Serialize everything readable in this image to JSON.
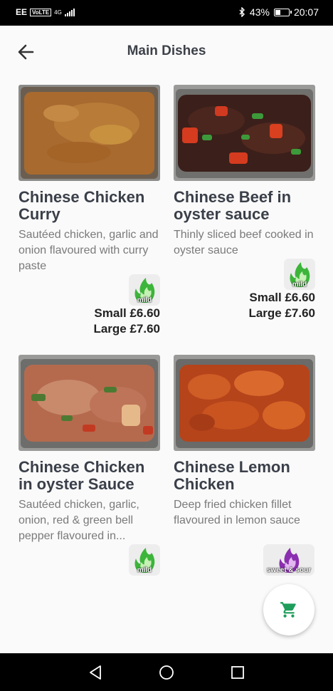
{
  "status_bar": {
    "carrier": "EE",
    "volte": "VoLTE",
    "network": "4G",
    "battery_percent": "43%",
    "battery_level": 0.43,
    "time": "20:07",
    "icons": [
      "signal-icon",
      "bluetooth-icon",
      "battery-icon"
    ]
  },
  "header": {
    "title": "Main Dishes",
    "back_icon": "arrow-left-icon"
  },
  "dishes": [
    {
      "name": "Chinese Chicken Curry",
      "description": "Sautéed chicken, garlic and onion flavoured with curry paste",
      "badge": "mild",
      "price_small": "Small £6.60",
      "price_large": "Large £7.60"
    },
    {
      "name": "Chinese Beef in oyster sauce",
      "description": "Thinly sliced beef cooked in oyster sauce",
      "badge": "mild",
      "price_small": "Small £6.60",
      "price_large": "Large £7.60"
    },
    {
      "name": "Chinese Chicken in oyster Sauce",
      "description": "Sautéed chicken, garlic, onion, red & green bell pepper flavoured in...",
      "badge": "mild"
    },
    {
      "name": "Chinese Lemon Chicken",
      "description": "Deep fried chicken fillet flavoured in lemon sauce",
      "badge": "sweet & sour"
    }
  ],
  "fab": {
    "icon": "shopping-cart-icon"
  },
  "nav_bar": {
    "icons": [
      "back-triangle-icon",
      "home-circle-icon",
      "recents-square-icon"
    ]
  },
  "colors": {
    "accent_green": "#1e9e5a",
    "mild_flame": "#3cb53a",
    "sweet_sour_flame": "#8b2fb0",
    "title_text": "#3a3f49"
  }
}
